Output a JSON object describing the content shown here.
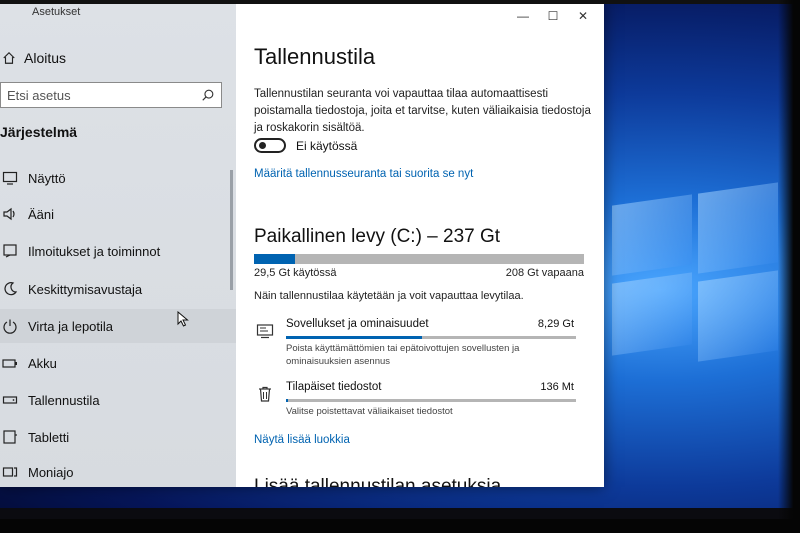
{
  "window": {
    "title": "Asetukset",
    "minimize_glyph": "—",
    "maximize_glyph": "☐",
    "close_glyph": "✕"
  },
  "nav": {
    "home_label": "Aloitus",
    "search_placeholder": "Etsi asetus",
    "section_label": "Järjestelmä",
    "items": [
      {
        "label": "Näyttö",
        "icon": "display-icon"
      },
      {
        "label": "Ääni",
        "icon": "sound-icon"
      },
      {
        "label": "Ilmoitukset ja toiminnot",
        "icon": "notifications-icon"
      },
      {
        "label": "Keskittymisavustaja",
        "icon": "focus-assist-icon"
      },
      {
        "label": "Virta ja lepotila",
        "icon": "power-icon"
      },
      {
        "label": "Akku",
        "icon": "battery-icon"
      },
      {
        "label": "Tallennustila",
        "icon": "storage-icon"
      },
      {
        "label": "Tabletti",
        "icon": "tablet-icon"
      },
      {
        "label": "Moniajo",
        "icon": "multitasking-icon"
      }
    ]
  },
  "content": {
    "title": "Tallennustila",
    "sense_description": "Tallennustilan seuranta voi vapauttaa tilaa automaattisesti poistamalla tiedostoja, joita et tarvitse, kuten väliaikaisia tiedostoja ja roskakorin sisältöä.",
    "toggle_label": "Ei käytössä",
    "toggle_on": false,
    "configure_link": "Määritä tallennusseuranta tai suorita se nyt",
    "drive": {
      "title": "Paikallinen levy (C:) – 237 Gt",
      "used_label": "29,5 Gt käytössä",
      "free_label": "208 Gt vapaana",
      "used_fraction": 0.124,
      "description": "Näin tallennustilaa käytetään ja voit vapauttaa levytilaa."
    },
    "categories": [
      {
        "name": "Sovellukset ja ominaisuudet",
        "size": "8,29 Gt",
        "fraction": 0.47,
        "description": "Poista käyttämättömien tai epätoivottujen sovellusten ja ominaisuuksien asennus",
        "icon": "apps-icon"
      },
      {
        "name": "Tilapäiset tiedostot",
        "size": "136 Mt",
        "fraction": 0.008,
        "description": "Valitse poistettavat väliaikaiset tiedostot",
        "icon": "trash-icon"
      }
    ],
    "more_link": "Näytä lisää luokkia",
    "settings_heading": "Lisää tallennustilan asetuksia"
  },
  "colors": {
    "accent": "#0063b1",
    "bar_track": "#b5b5b5",
    "nav_bg": "#dde1e6"
  }
}
